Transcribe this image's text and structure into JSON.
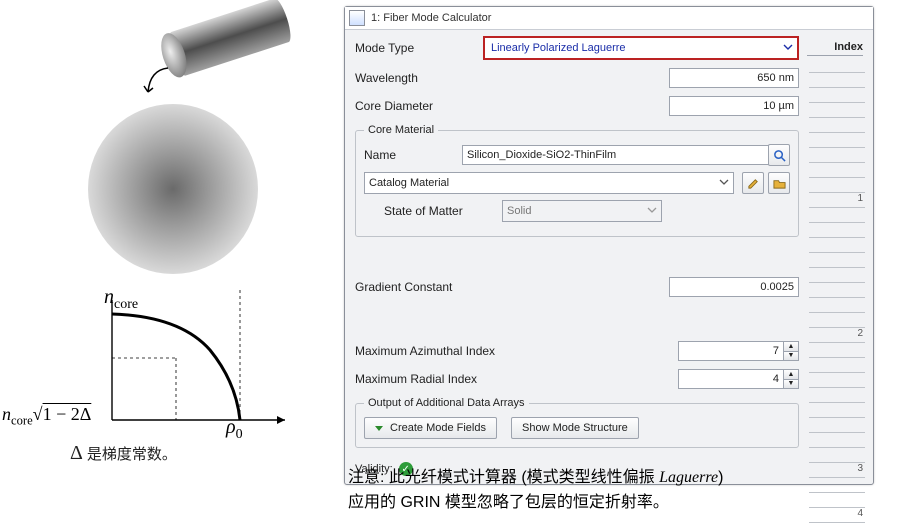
{
  "illustration": {
    "ncore_symbol": "n",
    "ncore_sub": "core",
    "y_axis_label": "n_core√(1−2Δ)",
    "rho_symbol": "ρ",
    "rho_sub": "0",
    "delta_symbol": "Δ",
    "delta_note": "是梯度常数。"
  },
  "dialog": {
    "title": "1: Fiber Mode Calculator",
    "index_header": "Index",
    "mode_type": {
      "label": "Mode Type",
      "value": "Linearly Polarized Laguerre"
    },
    "wavelength": {
      "label": "Wavelength",
      "value": "650 nm"
    },
    "core_diameter": {
      "label": "Core Diameter",
      "value": "10 µm"
    },
    "core_material": {
      "legend": "Core Material",
      "name_label": "Name",
      "name_value": "Silicon_Dioxide-SiO2-ThinFilm",
      "catalog_label": "Catalog Material",
      "state_label": "State of Matter",
      "state_value": "Solid"
    },
    "gradient": {
      "label": "Gradient Constant",
      "value": "0.0025"
    },
    "max_azimuthal": {
      "label": "Maximum Azimuthal Index",
      "value": "7"
    },
    "max_radial": {
      "label": "Maximum Radial Index",
      "value": "4"
    },
    "output": {
      "legend": "Output of Additional Data Arrays",
      "btn_create": "Create Mode Fields",
      "btn_show": "Show Mode Structure"
    },
    "validity_label": "Validity:",
    "index_ticks": [
      "",
      "",
      "",
      "",
      "",
      "",
      "",
      "",
      "",
      "1",
      "",
      "",
      "",
      "",
      "",
      "",
      "",
      "",
      "2",
      "",
      "",
      "",
      "",
      "",
      "",
      "",
      "",
      "3",
      "",
      "",
      "4"
    ]
  },
  "caption": {
    "line1_a": "注意: 此光纤模式计算器 (模式类型线性偏振 ",
    "line1_b": "Laguerre",
    "line1_c": ")",
    "line2": "应用的 GRIN 模型忽略了包层的恒定折射率。"
  }
}
